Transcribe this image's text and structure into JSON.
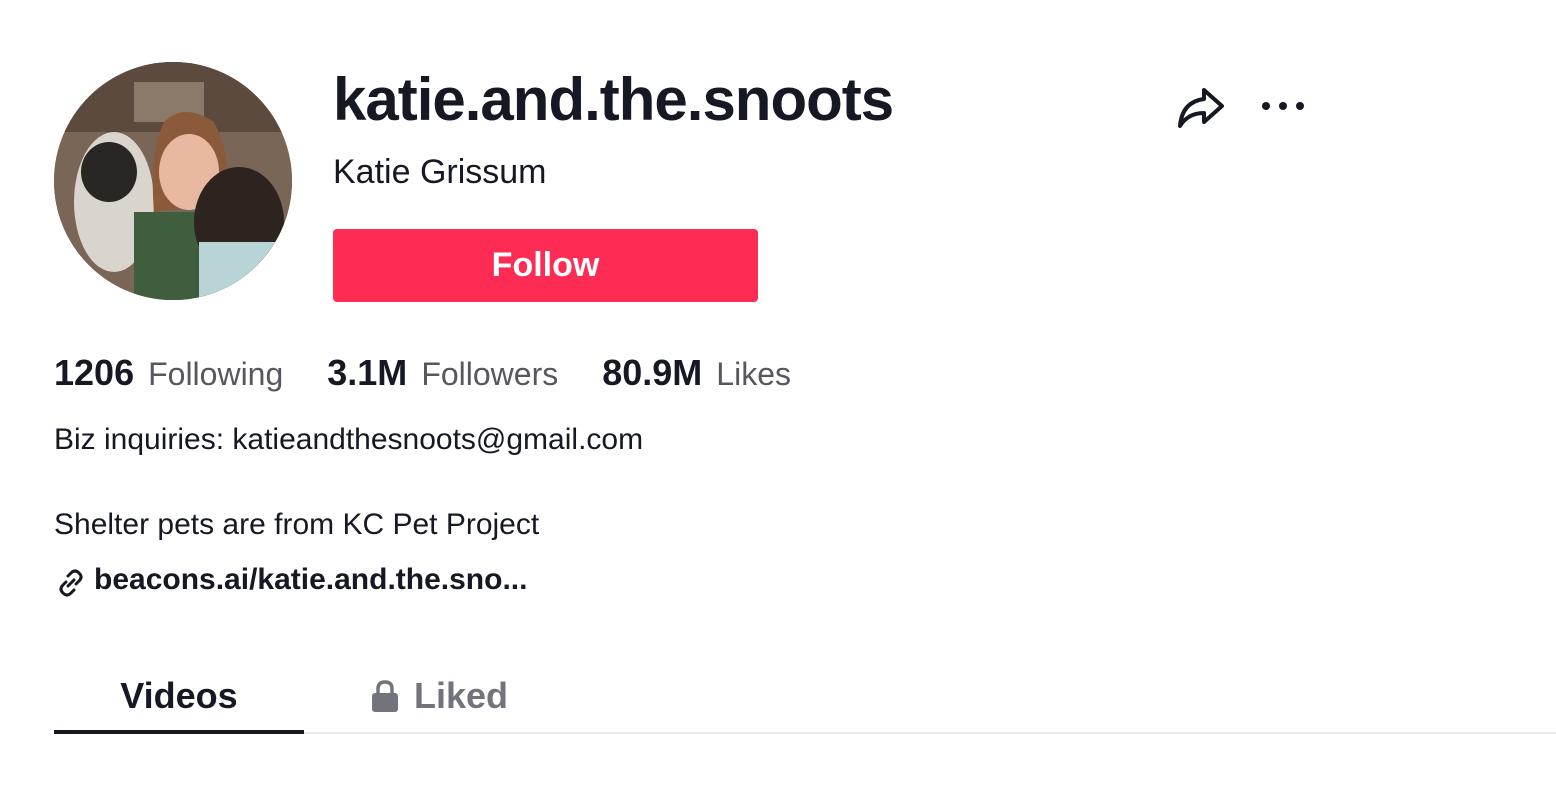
{
  "profile": {
    "username": "katie.and.the.snoots",
    "nickname": "Katie Grissum",
    "avatar_icon": "avatar"
  },
  "actions": {
    "follow_label": "Follow",
    "follow_color": "#fe2c55",
    "share_icon": "share-icon",
    "more_icon": "more-icon"
  },
  "stats": {
    "following": {
      "count": "1206",
      "label": "Following"
    },
    "followers": {
      "count": "3.1M",
      "label": "Followers"
    },
    "likes": {
      "count": "80.9M",
      "label": "Likes"
    }
  },
  "bio": {
    "line1": "Biz inquiries: katieandthesnoots@gmail.com",
    "line2": "Shelter pets are from KC Pet Project",
    "link": "beacons.ai/katie.and.the.sno..."
  },
  "tabs": [
    {
      "label": "Videos",
      "active": true
    },
    {
      "label": "Liked",
      "active": false,
      "icon": "lock-icon"
    }
  ]
}
